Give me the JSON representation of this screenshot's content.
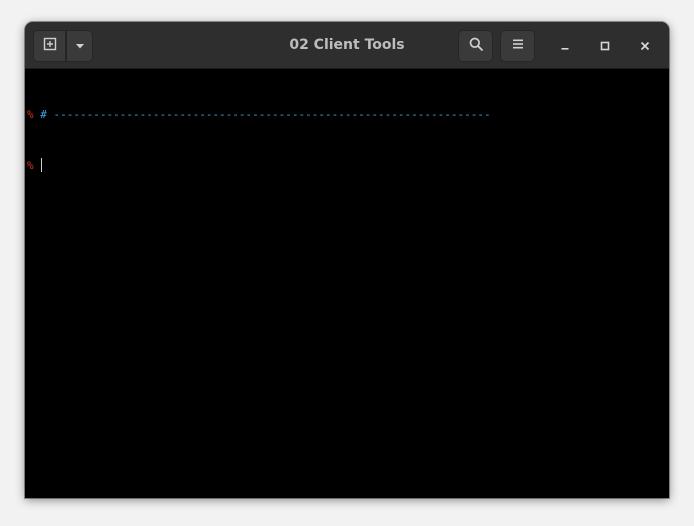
{
  "window": {
    "title": "02 Client Tools"
  },
  "headerbar": {
    "new_tab_icon": "new-tab-icon",
    "tab_menu_icon": "chevron-down-icon",
    "search_icon": "search-icon",
    "menu_icon": "hamburger-menu-icon",
    "minimize_icon": "minimize-icon",
    "maximize_icon": "maximize-icon",
    "close_icon": "close-icon"
  },
  "terminal": {
    "lines": [
      {
        "prompt": "% ",
        "text": "# ------------------------------------------------------------------"
      },
      {
        "prompt": "% ",
        "text": ""
      }
    ],
    "colors": {
      "prompt": "#e0331f",
      "comment": "#3fa8e8",
      "background": "#000000"
    }
  }
}
